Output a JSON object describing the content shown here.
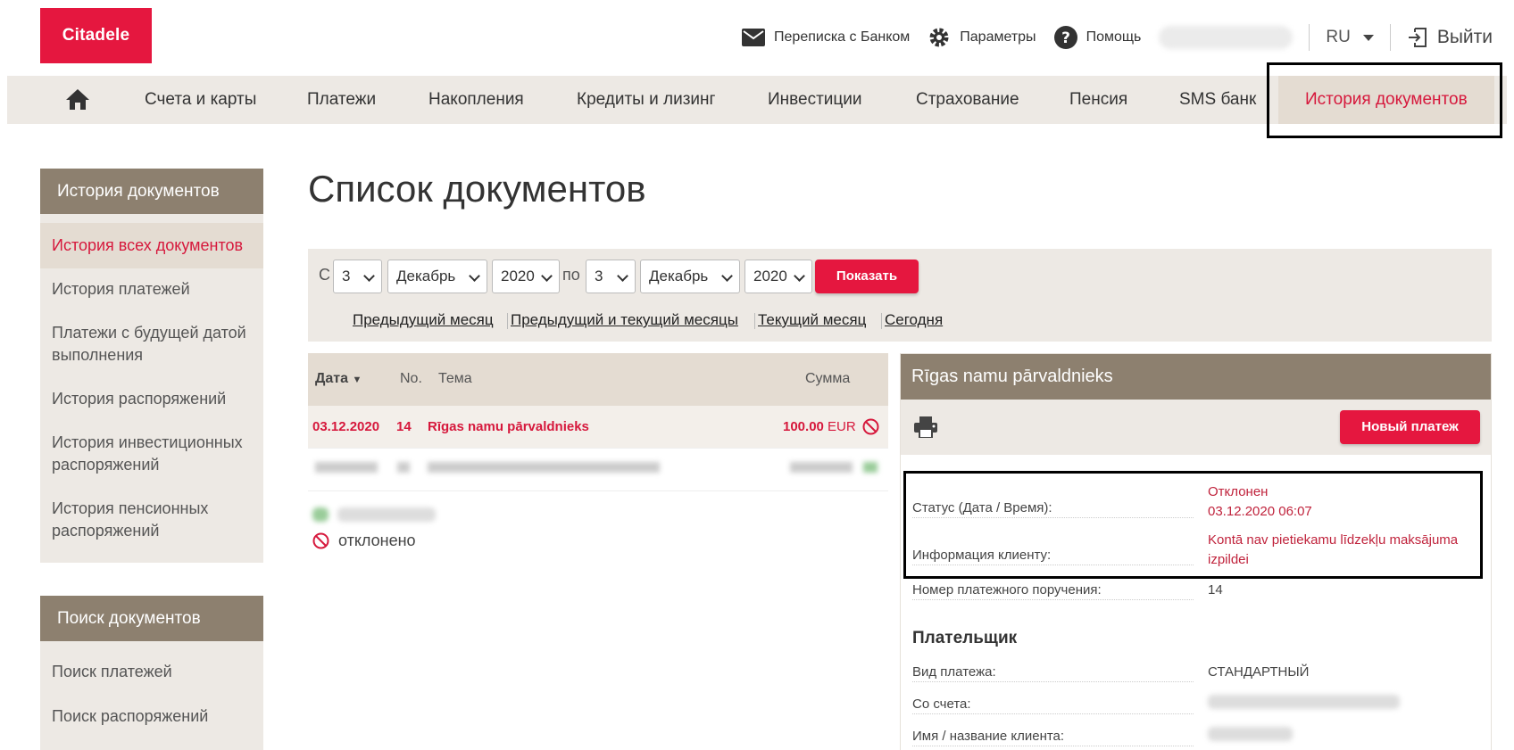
{
  "header": {
    "logo_text": "Citadele",
    "messages_label": "Переписка с Банком",
    "settings_label": "Параметры",
    "help_label": "Помощь",
    "language": "RU",
    "logout_label": "Выйти"
  },
  "nav": {
    "home_icon": "home-icon",
    "items": [
      {
        "label": "Счета и карты"
      },
      {
        "label": "Платежи"
      },
      {
        "label": "Накопления"
      },
      {
        "label": "Кредиты и лизинг"
      },
      {
        "label": "Инвестиции"
      },
      {
        "label": "Страхование"
      },
      {
        "label": "Пенсия"
      },
      {
        "label": "SMS банк"
      },
      {
        "label": "История документов"
      }
    ]
  },
  "sidebar": {
    "history_title": "История документов",
    "history_items": [
      {
        "label": "История всех документов"
      },
      {
        "label": "История платежей"
      },
      {
        "label": "Платежи с будущей датой выполнения"
      },
      {
        "label": "История распоряжений"
      },
      {
        "label": "История инвестиционных распоряжений"
      },
      {
        "label": "История пенсионных распоряжений"
      }
    ],
    "search_title": "Поиск документов",
    "search_items": [
      {
        "label": "Поиск платежей"
      },
      {
        "label": "Поиск распоряжений"
      }
    ]
  },
  "main": {
    "page_title": "Список документов"
  },
  "filter": {
    "from_label": "С",
    "to_label": "по",
    "from_day": "3",
    "from_month": "Декабрь",
    "from_year": "2020",
    "to_day": "3",
    "to_month": "Декабрь",
    "to_year": "2020",
    "show_button": "Показать",
    "quick_links": [
      {
        "label": "Предыдущий месяц"
      },
      {
        "label": "Предыдущий и текущий месяцы"
      },
      {
        "label": "Текущий месяц"
      },
      {
        "label": "Сегодня"
      }
    ]
  },
  "table": {
    "headers": {
      "date": "Дата",
      "no": "No.",
      "subject": "Тема",
      "amount": "Сумма"
    },
    "rows": [
      {
        "date": "03.12.2020",
        "no": "14",
        "subject": "Rīgas namu pārvaldnieks",
        "amount": "100.00",
        "currency": "EUR",
        "status_icon": "rejected-icon"
      }
    ],
    "legend_rejected": "отклонено"
  },
  "detail": {
    "title": "Rīgas namu pārvaldnieks",
    "new_payment_button": "Новый платеж",
    "status_label": "Статус (Дата / Время):",
    "status_value": "Отклонен",
    "status_datetime": "03.12.2020 06:07",
    "client_info_label": "Информация клиенту:",
    "client_info_value": "Kontā nav pietiekamu līdzekļu maksājuma izpildei",
    "order_number_label": "Номер платежного поручения:",
    "order_number_value": "14",
    "payer_title": "Плательщик",
    "payment_type_label": "Вид платежа:",
    "payment_type_value": "СТАНДАРТНЫЙ",
    "from_account_label": "Со счета:",
    "client_name_label": "Имя / название  клиента:"
  },
  "colors": {
    "brand_red": "#e5173f",
    "nav_bg": "#ede9e4",
    "header_brown": "#8d806f",
    "rejected_red": "#d6183c"
  }
}
